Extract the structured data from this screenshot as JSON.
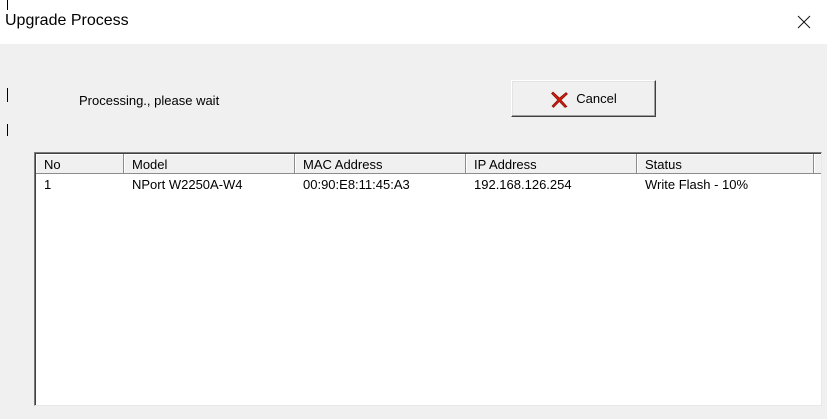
{
  "window": {
    "title": "Upgrade Process"
  },
  "status_text": "Processing., please wait",
  "cancel_button": {
    "label": "Cancel",
    "icon": "red-x-icon",
    "icon_color": "#cc1c0a"
  },
  "list": {
    "columns": [
      "No",
      "Model",
      "MAC Address",
      "IP Address",
      "Status"
    ],
    "rows": [
      {
        "no": "1",
        "model": "NPort W2250A-W4",
        "mac": "00:90:E8:11:45:A3",
        "ip": "192.168.126.254",
        "status": "Write Flash - 10%"
      }
    ]
  }
}
